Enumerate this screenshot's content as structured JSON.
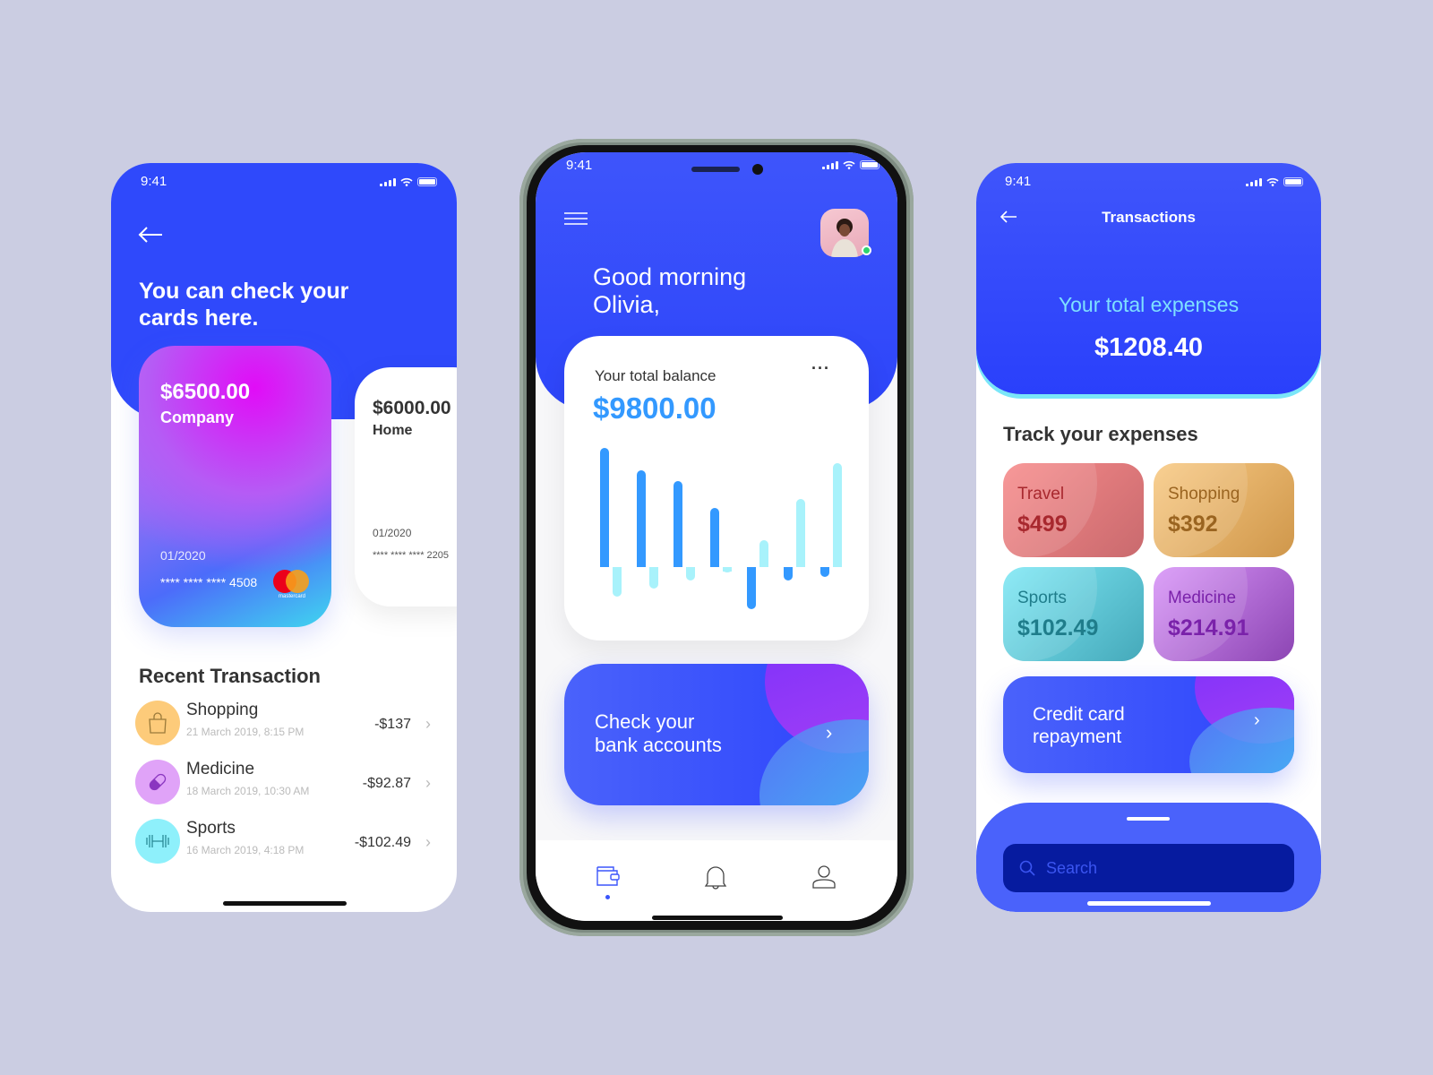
{
  "colors": {
    "background": "#cbcde2",
    "primary": "#2f49fb",
    "balance": "#3399ff",
    "bar_dark": "#3399ff",
    "bar_light": "#a8f2fb"
  },
  "left_screen": {
    "status_time": "9:41",
    "heading": "You can check your cards here.",
    "cards": [
      {
        "amount": "$6500.00",
        "name": "Company",
        "expiry": "01/2020",
        "number": "**** **** **** 4508",
        "brand": "mastercard"
      },
      {
        "amount": "$6000.00",
        "name": "Home",
        "expiry": "01/2020",
        "number": "**** **** **** 2205"
      }
    ],
    "recent_title": "Recent Transaction",
    "transactions": [
      {
        "name": "Shopping",
        "date": "21 March 2019, 8:15 PM",
        "amount": "-$137",
        "icon": "shopping-bag-icon",
        "color": "#fdcb7a"
      },
      {
        "name": "Medicine",
        "date": "18 March 2019, 10:30 AM",
        "amount": "-$92.87",
        "icon": "pill-icon",
        "color": "#e0a3f8"
      },
      {
        "name": "Sports",
        "date": "16 March 2019, 4:18 PM",
        "amount": "-$102.49",
        "icon": "dumbbell-icon",
        "color": "#8ef0fb"
      }
    ]
  },
  "middle_screen": {
    "status_time": "9:41",
    "greeting_line1": "Good morning",
    "greeting_line2": "Olivia,",
    "balance_label": "Your total balance",
    "balance_value": "$9800.00",
    "more_icon": "more-horizontal-icon",
    "promo": {
      "line1": "Check your",
      "line2": "bank accounts"
    },
    "nav": [
      {
        "icon": "wallet-icon",
        "active": true
      },
      {
        "icon": "bell-icon",
        "active": false
      },
      {
        "icon": "user-icon",
        "active": false
      }
    ]
  },
  "chart_data": {
    "type": "bar",
    "categories": [
      "1",
      "2",
      "3",
      "4",
      "5",
      "6",
      "7"
    ],
    "series": [
      {
        "values": [
          133,
          108,
          96,
          66,
          -47,
          -15,
          -11
        ],
        "color": "#3399ff"
      },
      {
        "values": [
          -33,
          -24,
          -15,
          -6,
          30,
          76,
          116
        ],
        "color": "#a8f2fb"
      }
    ],
    "title": "",
    "xlabel": "",
    "ylabel": "",
    "grid": false
  },
  "right_screen": {
    "status_time": "9:41",
    "title": "Transactions",
    "expenses_label": "Your total expenses",
    "expenses_value": "$1208.40",
    "track_title": "Track your expenses",
    "tiles": [
      {
        "label": "Travel",
        "value": "$499",
        "bg": "linear-gradient(135deg,#f78a8a,#c96a6e)",
        "text": "#a8282e"
      },
      {
        "label": "Shopping",
        "value": "$392",
        "bg": "linear-gradient(135deg,#f8c983,#cf974b)",
        "text": "#9a6420"
      },
      {
        "label": "Sports",
        "value": "$102.49",
        "bg": "linear-gradient(135deg,#7ee8f5,#45a9ba)",
        "text": "#1f7d8b"
      },
      {
        "label": "Medicine",
        "value": "$214.91",
        "bg": "linear-gradient(135deg,#d894f8,#8c45b3)",
        "text": "#7a22aa"
      }
    ],
    "promo": {
      "line1": "Credit card",
      "line2": "repayment"
    },
    "search_placeholder": "Search"
  }
}
